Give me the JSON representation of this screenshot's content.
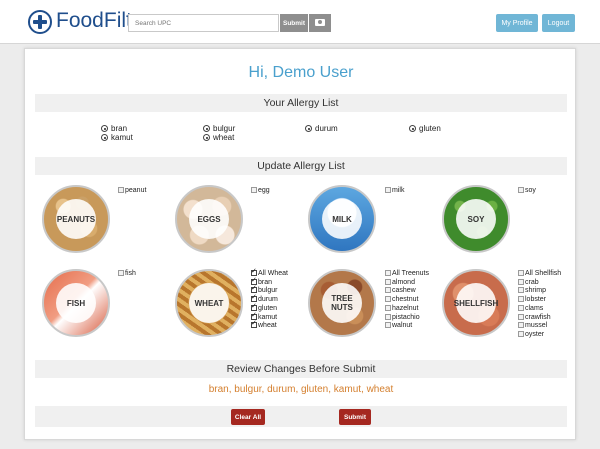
{
  "header": {
    "brand": "FoodFilter",
    "search_placeholder": "Search UPC",
    "submit_label": "Submit",
    "camera_icon": "camera-icon",
    "profile_label": "My Profile",
    "logout_label": "Logout"
  },
  "main": {
    "greeting": "Hi, Demo User",
    "allergy_list_title": "Your Allergy List",
    "allergy_list": [
      "bran",
      "bulgur",
      "durum",
      "gluten",
      "kamut",
      "wheat"
    ],
    "update_title": "Update Allergy List",
    "categories": [
      {
        "label": "PEANUTS",
        "options": [
          {
            "label": "peanut",
            "checked": false
          }
        ]
      },
      {
        "label": "EGGS",
        "options": [
          {
            "label": "egg",
            "checked": false
          }
        ]
      },
      {
        "label": "MILK",
        "options": [
          {
            "label": "milk",
            "checked": false
          }
        ]
      },
      {
        "label": "SOY",
        "options": [
          {
            "label": "soy",
            "checked": false
          }
        ]
      },
      {
        "label": "FISH",
        "options": [
          {
            "label": "fish",
            "checked": false
          }
        ]
      },
      {
        "label": "WHEAT",
        "options": [
          {
            "label": "All Wheat",
            "checked": true
          },
          {
            "label": "bran",
            "checked": true
          },
          {
            "label": "bulgur",
            "checked": true
          },
          {
            "label": "durum",
            "checked": true
          },
          {
            "label": "gluten",
            "checked": true
          },
          {
            "label": "kamut",
            "checked": true
          },
          {
            "label": "wheat",
            "checked": true
          }
        ]
      },
      {
        "label_line1": "TREE",
        "label_line2": "NUTS",
        "options": [
          {
            "label": "All Treenuts",
            "checked": false
          },
          {
            "label": "almond",
            "checked": false
          },
          {
            "label": "cashew",
            "checked": false
          },
          {
            "label": "chestnut",
            "checked": false
          },
          {
            "label": "hazelnut",
            "checked": false
          },
          {
            "label": "pistachio",
            "checked": false
          },
          {
            "label": "walnut",
            "checked": false
          }
        ]
      },
      {
        "label": "SHELLFISH",
        "options": [
          {
            "label": "All Shellfish",
            "checked": false
          },
          {
            "label": "crab",
            "checked": false
          },
          {
            "label": "shrimp",
            "checked": false
          },
          {
            "label": "lobster",
            "checked": false
          },
          {
            "label": "clams",
            "checked": false
          },
          {
            "label": "crawfish",
            "checked": false
          },
          {
            "label": "mussel",
            "checked": false
          },
          {
            "label": "oyster",
            "checked": false
          }
        ]
      }
    ],
    "review_title": "Review Changes Before Submit",
    "review_text": "bran, bulgur, durum, gluten, kamut, wheat",
    "clear_label": "Clear All",
    "submit_label": "Submit"
  },
  "colors": {
    "brand": "#1f4e8c",
    "accent": "#4aa0cd",
    "header_button": "#70b6d6",
    "danger": "#a52820",
    "review": "#d47f2e"
  }
}
